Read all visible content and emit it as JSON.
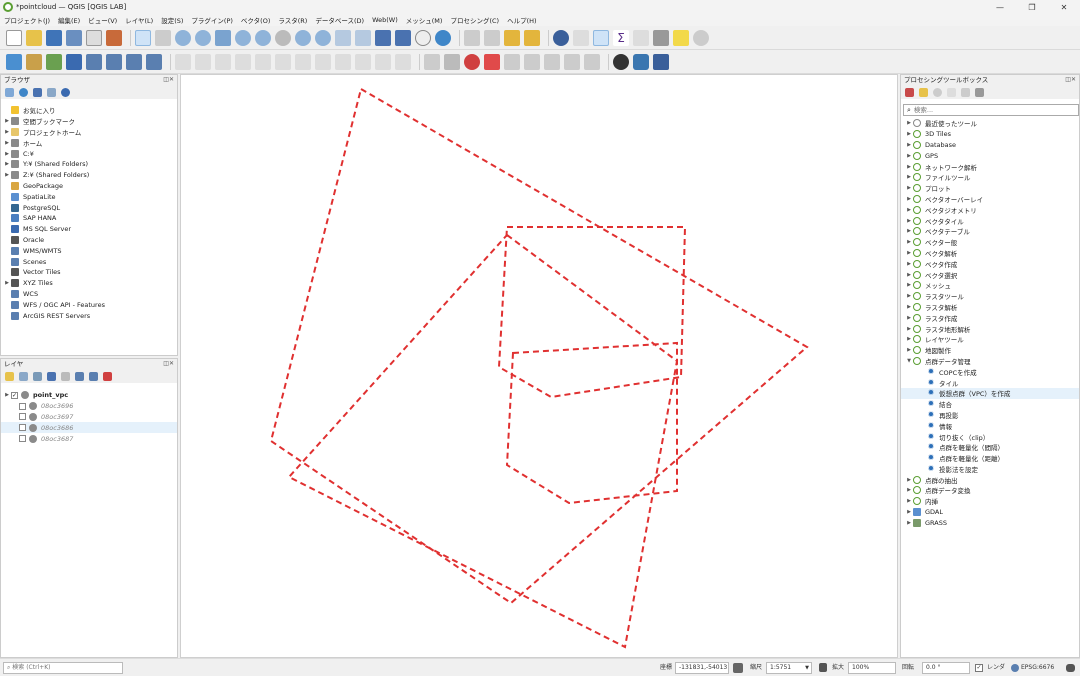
{
  "window": {
    "title": "*pointcloud — QGIS [QGIS LAB]",
    "controls": [
      "—",
      "❐",
      "✕"
    ]
  },
  "menu": [
    "プロジェクト(J)",
    "編集(E)",
    "ビュー(V)",
    "レイヤ(L)",
    "設定(S)",
    "プラグイン(P)",
    "ベクタ(O)",
    "ラスタ(R)",
    "データベース(D)",
    "Web(W)",
    "メッシュ(M)",
    "プロセシング(C)",
    "ヘルプ(H)"
  ],
  "browser": {
    "title": "ブラウザ",
    "items": [
      {
        "label": "お気に入り",
        "expand": false,
        "icon": "star-icon",
        "color": "#f2c230"
      },
      {
        "label": "空間ブックマーク",
        "expand": true,
        "icon": "bookmark-icon",
        "color": "#8a8a8a"
      },
      {
        "label": "プロジェクトホーム",
        "expand": true,
        "icon": "home-folder-icon",
        "color": "#e7c66a"
      },
      {
        "label": "ホーム",
        "expand": true,
        "icon": "home-icon",
        "color": "#8a8a8a"
      },
      {
        "label": "C:¥",
        "expand": true,
        "icon": "drive-icon",
        "color": "#8a8a8a"
      },
      {
        "label": "Y:¥ (Shared Folders)",
        "expand": true,
        "icon": "drive-icon",
        "color": "#8a8a8a"
      },
      {
        "label": "Z:¥ (Shared Folders)",
        "expand": true,
        "icon": "drive-icon",
        "color": "#8a8a8a"
      },
      {
        "label": "GeoPackage",
        "expand": false,
        "icon": "geopackage-icon",
        "color": "#d9a641"
      },
      {
        "label": "SpatiaLite",
        "expand": false,
        "icon": "spatialite-icon",
        "color": "#5a8fd0"
      },
      {
        "label": "PostgreSQL",
        "expand": false,
        "icon": "postgresql-icon",
        "color": "#336791"
      },
      {
        "label": "SAP HANA",
        "expand": false,
        "icon": "sap-hana-icon",
        "color": "#4a7fc0"
      },
      {
        "label": "MS SQL Server",
        "expand": false,
        "icon": "mssql-icon",
        "color": "#3a6ab0"
      },
      {
        "label": "Oracle",
        "expand": false,
        "icon": "oracle-icon",
        "color": "#555"
      },
      {
        "label": "WMS/WMTS",
        "expand": false,
        "icon": "wms-icon",
        "color": "#5a7fb0"
      },
      {
        "label": "Scenes",
        "expand": false,
        "icon": "scenes-icon",
        "color": "#5a7fb0"
      },
      {
        "label": "Vector Tiles",
        "expand": false,
        "icon": "vector-tiles-icon",
        "color": "#555"
      },
      {
        "label": "XYZ Tiles",
        "expand": true,
        "icon": "xyz-tiles-icon",
        "color": "#555"
      },
      {
        "label": "WCS",
        "expand": false,
        "icon": "wcs-icon",
        "color": "#5a7fb0"
      },
      {
        "label": "WFS / OGC API - Features",
        "expand": false,
        "icon": "wfs-icon",
        "color": "#5a7fb0"
      },
      {
        "label": "ArcGIS REST Servers",
        "expand": false,
        "icon": "arcgis-icon",
        "color": "#5a7fb0"
      }
    ]
  },
  "layers": {
    "title": "レイヤ",
    "items": [
      {
        "label": "point_vpc",
        "checked": true,
        "bold": true,
        "expand": true
      },
      {
        "label": "08oc3696",
        "checked": false,
        "italic": true
      },
      {
        "label": "08oc3697",
        "checked": false,
        "italic": true
      },
      {
        "label": "08oc3686",
        "checked": false,
        "italic": true,
        "selected": true
      },
      {
        "label": "08oc3687",
        "checked": false,
        "italic": true
      }
    ]
  },
  "toolbox": {
    "title": "プロセシングツールボックス",
    "search_placeholder": "検索...",
    "items": [
      {
        "label": "最近使ったツール",
        "icon": "clock-icon",
        "level": 0,
        "expand": true
      },
      {
        "label": "3D Tiles",
        "icon": "qgis-icon",
        "level": 0,
        "expand": true
      },
      {
        "label": "Database",
        "icon": "qgis-icon",
        "level": 0,
        "expand": true
      },
      {
        "label": "GPS",
        "icon": "qgis-icon",
        "level": 0,
        "expand": true
      },
      {
        "label": "ネットワーク解析",
        "icon": "qgis-icon",
        "level": 0,
        "expand": true
      },
      {
        "label": "ファイルツール",
        "icon": "qgis-icon",
        "level": 0,
        "expand": true
      },
      {
        "label": "プロット",
        "icon": "qgis-icon",
        "level": 0,
        "expand": true
      },
      {
        "label": "ベクタオーバーレイ",
        "icon": "qgis-icon",
        "level": 0,
        "expand": true
      },
      {
        "label": "ベクタジオメトリ",
        "icon": "qgis-icon",
        "level": 0,
        "expand": true
      },
      {
        "label": "ベクタタイル",
        "icon": "qgis-icon",
        "level": 0,
        "expand": true
      },
      {
        "label": "ベクタテーブル",
        "icon": "qgis-icon",
        "level": 0,
        "expand": true
      },
      {
        "label": "ベクター般",
        "icon": "qgis-icon",
        "level": 0,
        "expand": true
      },
      {
        "label": "ベクタ解析",
        "icon": "qgis-icon",
        "level": 0,
        "expand": true
      },
      {
        "label": "ベクタ作成",
        "icon": "qgis-icon",
        "level": 0,
        "expand": true
      },
      {
        "label": "ベクタ選択",
        "icon": "qgis-icon",
        "level": 0,
        "expand": true
      },
      {
        "label": "メッシュ",
        "icon": "qgis-icon",
        "level": 0,
        "expand": true
      },
      {
        "label": "ラスタツール",
        "icon": "qgis-icon",
        "level": 0,
        "expand": true
      },
      {
        "label": "ラスタ解析",
        "icon": "qgis-icon",
        "level": 0,
        "expand": true
      },
      {
        "label": "ラスタ作成",
        "icon": "qgis-icon",
        "level": 0,
        "expand": true
      },
      {
        "label": "ラスタ地形解析",
        "icon": "qgis-icon",
        "level": 0,
        "expand": true
      },
      {
        "label": "レイヤツール",
        "icon": "qgis-icon",
        "level": 0,
        "expand": true
      },
      {
        "label": "地図製作",
        "icon": "qgis-icon",
        "level": 0,
        "expand": true
      },
      {
        "label": "点群データ管理",
        "icon": "qgis-icon",
        "level": 0,
        "expand": true,
        "open": true
      },
      {
        "label": "COPCを作成",
        "icon": "gear-icon",
        "level": 1
      },
      {
        "label": "タイル",
        "icon": "gear-icon",
        "level": 1
      },
      {
        "label": "仮想点群（VPC）を作成",
        "icon": "gear-icon",
        "level": 1,
        "selected": true
      },
      {
        "label": "結合",
        "icon": "gear-icon",
        "level": 1
      },
      {
        "label": "再投影",
        "icon": "gear-icon",
        "level": 1
      },
      {
        "label": "情報",
        "icon": "gear-icon",
        "level": 1
      },
      {
        "label": "切り抜く（clip）",
        "icon": "gear-icon",
        "level": 1
      },
      {
        "label": "点群を軽量化（間隔）",
        "icon": "gear-icon",
        "level": 1
      },
      {
        "label": "点群を軽量化（距離）",
        "icon": "gear-icon",
        "level": 1
      },
      {
        "label": "投影法を設定",
        "icon": "gear-icon",
        "level": 1
      },
      {
        "label": "点群の抽出",
        "icon": "qgis-icon",
        "level": 0,
        "expand": true
      },
      {
        "label": "点群データ変換",
        "icon": "qgis-icon",
        "level": 0,
        "expand": true
      },
      {
        "label": "内挿",
        "icon": "qgis-icon",
        "level": 0,
        "expand": true
      },
      {
        "label": "GDAL",
        "icon": "gdal-icon",
        "level": 0,
        "expand": true
      },
      {
        "label": "GRASS",
        "icon": "grass-icon",
        "level": 0,
        "expand": true
      }
    ]
  },
  "status": {
    "search_placeholder": "検索 (Ctrl+K)",
    "coord_label": "座標",
    "coord_value": "-131831,-54013",
    "scale_label": "縮尺",
    "scale_value": "1:5751",
    "magnify_label": "拡大",
    "magnify_value": "100%",
    "rotation_label": "回転",
    "rotation_value": "0.0 °",
    "render_label": "レンダ",
    "crs": "EPSG:6676"
  },
  "colors": {
    "footprint": "#e03030",
    "accent": "#5a9e32"
  }
}
